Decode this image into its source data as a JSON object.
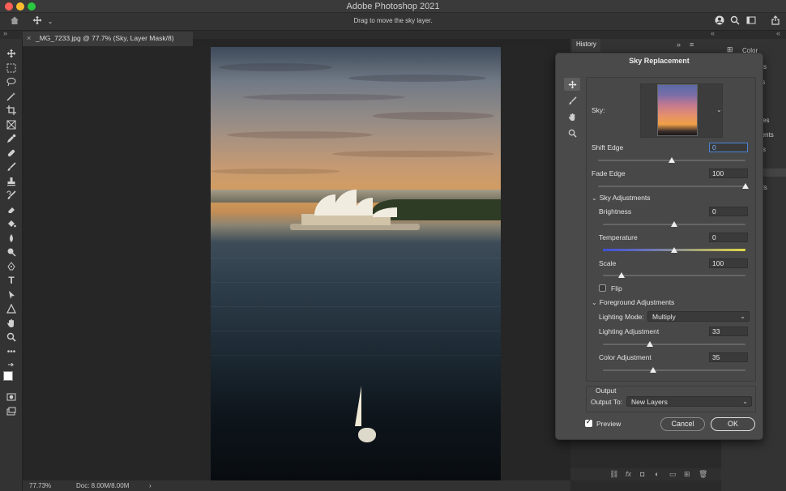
{
  "app": {
    "title": "Adobe Photoshop 2021"
  },
  "options_bar": {
    "hint": "Drag to move the sky layer."
  },
  "document_tab": {
    "label": "_MG_7233.jpg @ 77.7% (Sky, Layer Mask/8)",
    "close": "×"
  },
  "panels": {
    "history_tab": "History",
    "color_tab": "Color",
    "fragments": [
      "s",
      "ts",
      "es",
      "ments",
      "s",
      "ls"
    ]
  },
  "status_bar": {
    "zoom": "77.73%",
    "doc": "Doc: 8.00M/8.00M",
    "arrow": "›"
  },
  "dialog": {
    "title": "Sky Replacement",
    "sky_label": "Sky:",
    "shift_edge": {
      "label": "Shift Edge",
      "value": "0",
      "slider": 0.5
    },
    "fade_edge": {
      "label": "Fade Edge",
      "value": "100",
      "slider": 1.0
    },
    "sky_adjustments": {
      "header": "Sky Adjustments",
      "brightness": {
        "label": "Brightness",
        "value": "0",
        "slider": 0.5
      },
      "temperature": {
        "label": "Temperature",
        "value": "0",
        "slider": 0.5
      },
      "scale": {
        "label": "Scale",
        "value": "100",
        "slider": 0.13
      },
      "flip_label": "Flip",
      "flip_checked": false
    },
    "foreground_adjustments": {
      "header": "Foreground Adjustments",
      "lighting_mode_label": "Lighting Mode:",
      "lighting_mode_value": "Multiply",
      "lighting_adjustment": {
        "label": "Lighting Adjustment",
        "value": "33",
        "slider": 0.33
      },
      "color_adjustment": {
        "label": "Color Adjustment",
        "value": "35",
        "slider": 0.35
      }
    },
    "output": {
      "header": "Output",
      "output_to_label": "Output To:",
      "output_to_value": "New Layers"
    },
    "preview_label": "Preview",
    "preview_checked": true,
    "cancel_label": "Cancel",
    "ok_label": "OK"
  },
  "colors": {
    "accent": "#4b83d6",
    "dialog_bg": "#4a4a4a",
    "toolbar_bg": "#333333"
  }
}
